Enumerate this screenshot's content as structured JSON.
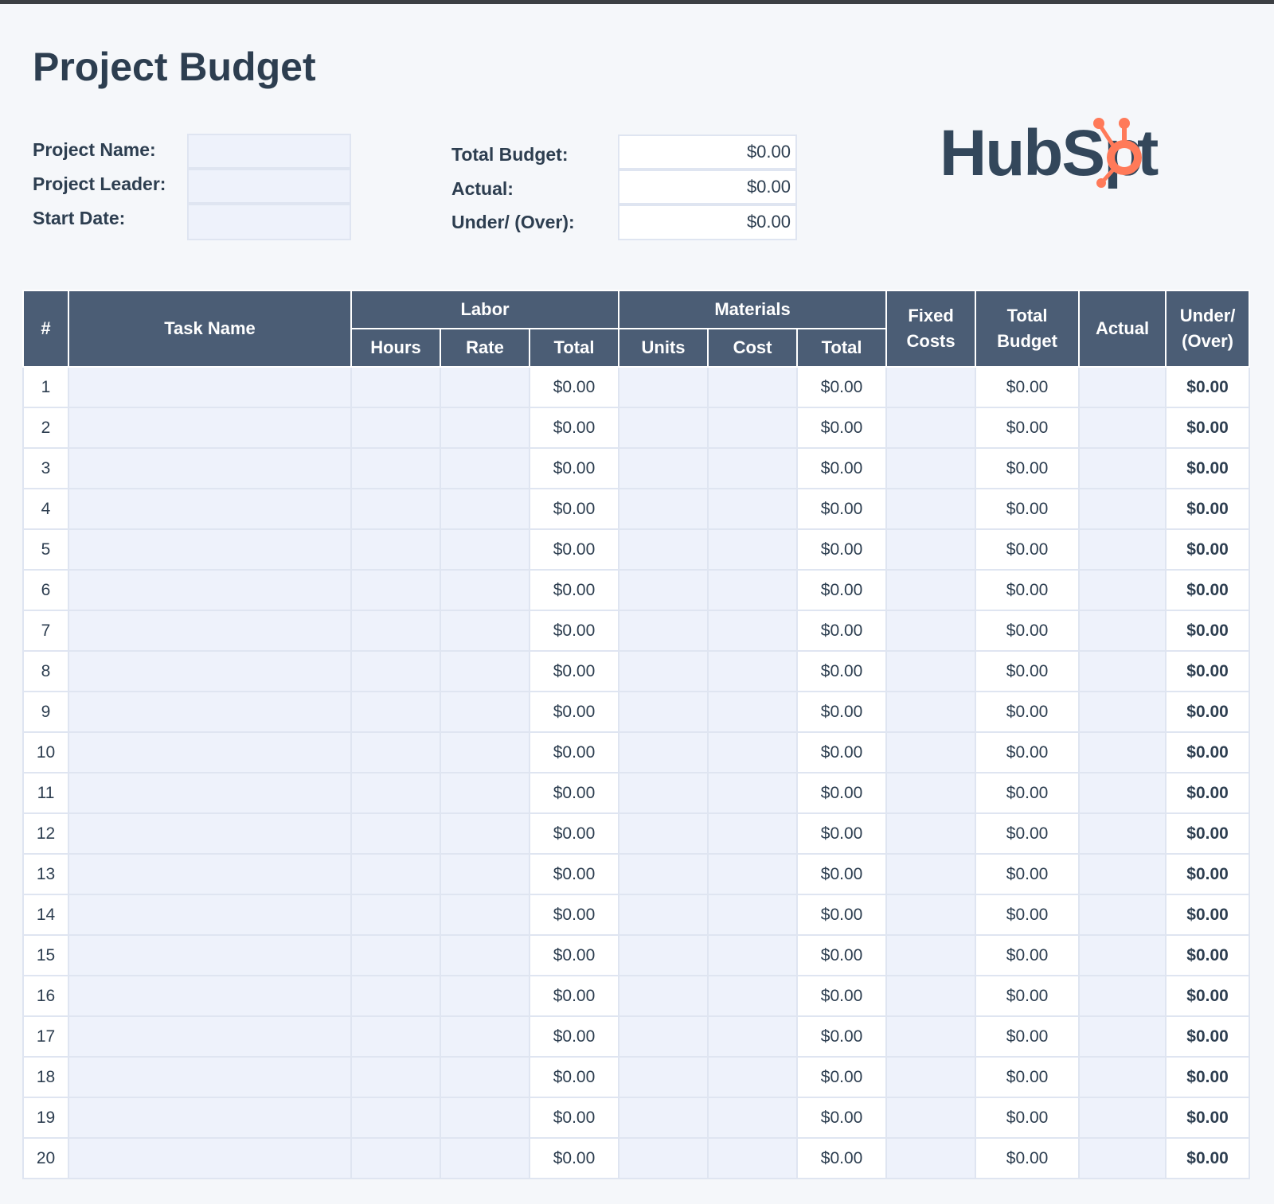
{
  "title": "Project Budget",
  "info": {
    "project_name_label": "Project Name:",
    "project_leader_label": "Project Leader:",
    "start_date_label": "Start Date:",
    "project_name_value": "",
    "project_leader_value": "",
    "start_date_value": ""
  },
  "summary": {
    "total_budget_label": "Total Budget:",
    "actual_label": "Actual:",
    "under_over_label": "Under/ (Over):",
    "total_budget_value": "$0.00",
    "actual_value": "$0.00",
    "under_over_value": "$0.00"
  },
  "logo": {
    "text": "HubSpot",
    "colors": {
      "text": "#33475b",
      "sprocket": "#ff7a59"
    }
  },
  "colors": {
    "header_bg": "#4b5d75",
    "input_bg": "#eef2fb",
    "page_bg": "#f5f7fa"
  },
  "table": {
    "headers": {
      "number": "#",
      "task_name": "Task Name",
      "labor": "Labor",
      "materials": "Materials",
      "fixed_costs": "Fixed Costs",
      "total_budget": "Total Budget",
      "actual": "Actual",
      "under_over": "Under/ (Over)",
      "hours": "Hours",
      "rate": "Rate",
      "labor_total": "Total",
      "units": "Units",
      "cost": "Cost",
      "materials_total": "Total"
    },
    "rows": [
      {
        "n": "1",
        "labor_total": "$0.00",
        "materials_total": "$0.00",
        "total_budget": "$0.00",
        "under_over": "$0.00"
      },
      {
        "n": "2",
        "labor_total": "$0.00",
        "materials_total": "$0.00",
        "total_budget": "$0.00",
        "under_over": "$0.00"
      },
      {
        "n": "3",
        "labor_total": "$0.00",
        "materials_total": "$0.00",
        "total_budget": "$0.00",
        "under_over": "$0.00"
      },
      {
        "n": "4",
        "labor_total": "$0.00",
        "materials_total": "$0.00",
        "total_budget": "$0.00",
        "under_over": "$0.00"
      },
      {
        "n": "5",
        "labor_total": "$0.00",
        "materials_total": "$0.00",
        "total_budget": "$0.00",
        "under_over": "$0.00"
      },
      {
        "n": "6",
        "labor_total": "$0.00",
        "materials_total": "$0.00",
        "total_budget": "$0.00",
        "under_over": "$0.00"
      },
      {
        "n": "7",
        "labor_total": "$0.00",
        "materials_total": "$0.00",
        "total_budget": "$0.00",
        "under_over": "$0.00"
      },
      {
        "n": "8",
        "labor_total": "$0.00",
        "materials_total": "$0.00",
        "total_budget": "$0.00",
        "under_over": "$0.00"
      },
      {
        "n": "9",
        "labor_total": "$0.00",
        "materials_total": "$0.00",
        "total_budget": "$0.00",
        "under_over": "$0.00"
      },
      {
        "n": "10",
        "labor_total": "$0.00",
        "materials_total": "$0.00",
        "total_budget": "$0.00",
        "under_over": "$0.00"
      },
      {
        "n": "11",
        "labor_total": "$0.00",
        "materials_total": "$0.00",
        "total_budget": "$0.00",
        "under_over": "$0.00"
      },
      {
        "n": "12",
        "labor_total": "$0.00",
        "materials_total": "$0.00",
        "total_budget": "$0.00",
        "under_over": "$0.00"
      },
      {
        "n": "13",
        "labor_total": "$0.00",
        "materials_total": "$0.00",
        "total_budget": "$0.00",
        "under_over": "$0.00"
      },
      {
        "n": "14",
        "labor_total": "$0.00",
        "materials_total": "$0.00",
        "total_budget": "$0.00",
        "under_over": "$0.00"
      },
      {
        "n": "15",
        "labor_total": "$0.00",
        "materials_total": "$0.00",
        "total_budget": "$0.00",
        "under_over": "$0.00"
      },
      {
        "n": "16",
        "labor_total": "$0.00",
        "materials_total": "$0.00",
        "total_budget": "$0.00",
        "under_over": "$0.00"
      },
      {
        "n": "17",
        "labor_total": "$0.00",
        "materials_total": "$0.00",
        "total_budget": "$0.00",
        "under_over": "$0.00"
      },
      {
        "n": "18",
        "labor_total": "$0.00",
        "materials_total": "$0.00",
        "total_budget": "$0.00",
        "under_over": "$0.00"
      },
      {
        "n": "19",
        "labor_total": "$0.00",
        "materials_total": "$0.00",
        "total_budget": "$0.00",
        "under_over": "$0.00"
      },
      {
        "n": "20",
        "labor_total": "$0.00",
        "materials_total": "$0.00",
        "total_budget": "$0.00",
        "under_over": "$0.00"
      }
    ]
  }
}
